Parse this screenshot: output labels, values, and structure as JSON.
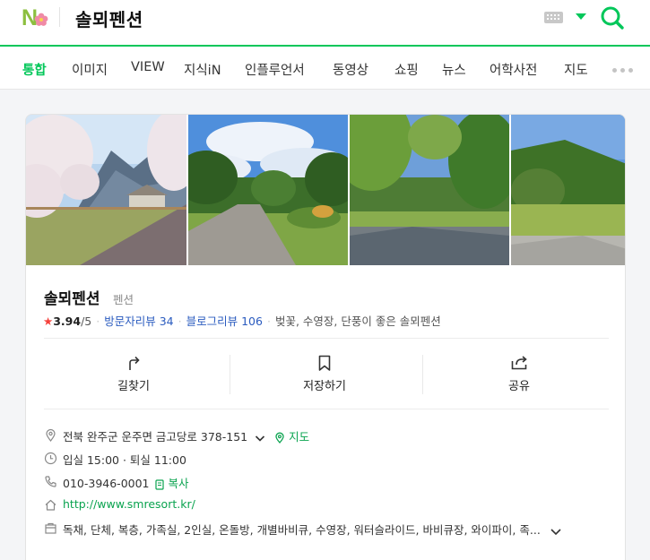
{
  "header": {
    "query": "솔뫼펜션",
    "logo_letter": "N",
    "colors": {
      "brand_green": "#03c75a",
      "accent_pink": "#f08aa6"
    }
  },
  "tabs": [
    {
      "label": "통합",
      "active": true
    },
    {
      "label": "이미지",
      "active": false
    },
    {
      "label": "VIEW",
      "active": false
    },
    {
      "label": "지식iN",
      "active": false
    },
    {
      "label": "인플루언서",
      "active": false
    },
    {
      "label": "동영상",
      "active": false
    },
    {
      "label": "쇼핑",
      "active": false
    },
    {
      "label": "뉴스",
      "active": false
    },
    {
      "label": "어학사전",
      "active": false
    },
    {
      "label": "지도",
      "active": false
    }
  ],
  "place": {
    "name": "솔뫼펜션",
    "category": "펜션",
    "rating_star": "★",
    "rating": "3.94",
    "rating_max": "/5",
    "visitor_reviews_label": "방문자리뷰",
    "visitor_reviews_count": "34",
    "blog_reviews_label": "블로그리뷰",
    "blog_reviews_count": "106",
    "tagline": "벚꽃, 수영장, 단풍이 좋은 솔뫼펜션"
  },
  "actions": [
    {
      "label": "길찾기",
      "icon": "directions-icon"
    },
    {
      "label": "저장하기",
      "icon": "bookmark-icon"
    },
    {
      "label": "공유",
      "icon": "share-icon"
    }
  ],
  "info": {
    "address": "전북 완주군 운주면 금고당로 378-151",
    "map_link": "지도",
    "hours": "입실 15:00 · 퇴실 11:00",
    "phone": "010-3946-0001",
    "copy_label": "복사",
    "website": "http://www.smresort.kr/",
    "amenities": "독채, 단체, 복층, 가족실, 2인실, 온돌방, 개별바비큐, 수영장, 워터슬라이드, 바비큐장, 와이파이, 족..."
  }
}
